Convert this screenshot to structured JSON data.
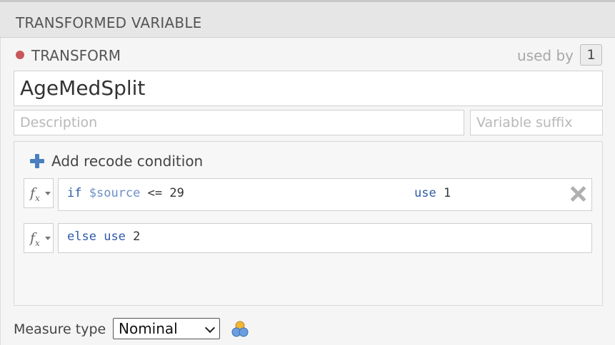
{
  "header": {
    "title": "TRANSFORMED VARIABLE"
  },
  "transform": {
    "label": "TRANSFORM",
    "status_color": "#c8575b",
    "used_by_label": "used by",
    "used_by_count": "1"
  },
  "fields": {
    "name_value": "AgeMedSplit",
    "description_placeholder": "Description",
    "suffix_placeholder": "Variable suffix"
  },
  "recode": {
    "add_label": "Add recode condition",
    "conditions": [
      {
        "if": "if",
        "var": "$source",
        "expr": " <= 29",
        "use": "use",
        "value": " 1"
      },
      {
        "else": "else",
        "use": "use",
        "value": " 2"
      }
    ]
  },
  "measure": {
    "label": "Measure type",
    "selected": "Nominal",
    "icon": "nominal-icon"
  },
  "colors": {
    "accent": "#4a7fc0",
    "keyword": "#2f5ba8"
  }
}
